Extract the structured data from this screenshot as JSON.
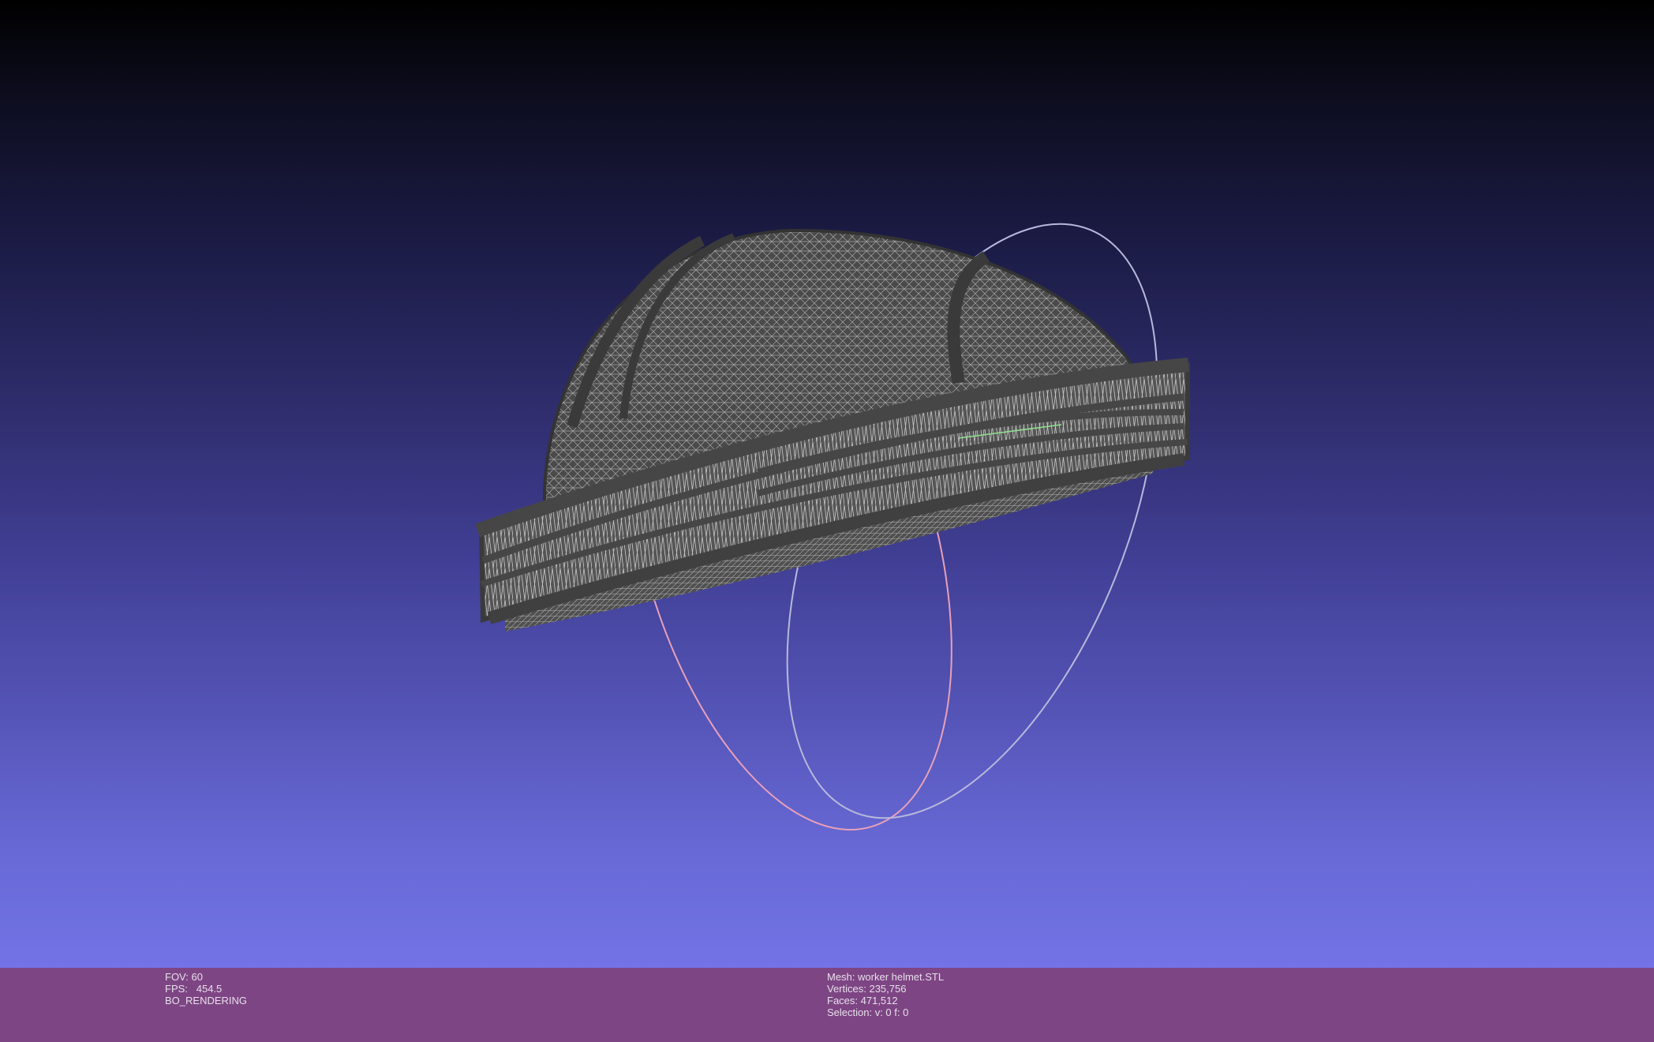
{
  "viewer": {
    "left_info": {
      "fov": "FOV: 60",
      "fps": "FPS:   454.5",
      "render_mode": "BO_RENDERING"
    },
    "right_info": {
      "mesh": "Mesh: worker helmet.STL",
      "vertices": "Vertices: 235,756",
      "faces": "Faces: 471,512",
      "selection": "Selection: v: 0 f: 0"
    },
    "colors": {
      "info_bar": "#7e4584",
      "mesh": "#4a4a4a",
      "wire": "#9a9a9a",
      "trackball_x": "#e8a0b8",
      "trackball_y": "#b0b0d8",
      "trackball_z": "#90e090"
    }
  }
}
